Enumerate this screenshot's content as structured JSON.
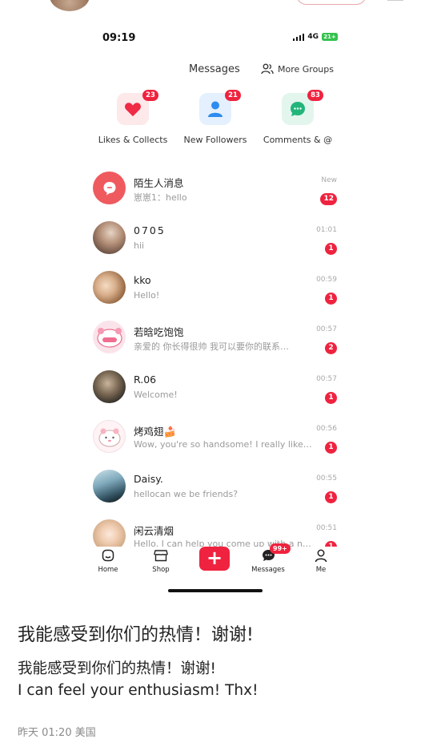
{
  "status_bar": {
    "time": "09:19",
    "network": "4G",
    "battery": "21+"
  },
  "header": {
    "title": "Messages",
    "more_groups": "More Groups"
  },
  "categories": [
    {
      "label": "Likes & Collects",
      "badge": "23",
      "icon": "heart-icon",
      "color": "#ef2b45"
    },
    {
      "label": "New Followers",
      "badge": "21",
      "icon": "person-icon",
      "color": "#2d8cf0"
    },
    {
      "label": "Comments & @",
      "badge": "83",
      "icon": "chat-bubble-icon",
      "color": "#22b57a"
    }
  ],
  "conversations": [
    {
      "name": "陌生人消息",
      "preview": "崽崽1：hello",
      "time": "New",
      "badge": "12",
      "avatar": "stranger-message-icon"
    },
    {
      "name": "0705",
      "preview": "hii",
      "time": "01:01",
      "badge": "1"
    },
    {
      "name": "kko",
      "preview": "Hello!",
      "time": "00:59",
      "badge": "1"
    },
    {
      "name": "若晗吃饱饱",
      "preview": "亲爱的 你长得很帅 我可以要你的联系…",
      "time": "00:57",
      "badge": "2"
    },
    {
      "name": "R.06",
      "preview": "Welcome!",
      "time": "00:57",
      "badge": "1"
    },
    {
      "name": "烤鸡翅🍰",
      "preview": "Wow, you're so handsome! I really like…",
      "time": "00:56",
      "badge": "1"
    },
    {
      "name": "Daisy.",
      "preview": "hellocan we be friends?",
      "time": "00:55",
      "badge": "1"
    },
    {
      "name": "闲云清烟",
      "preview": "Hello. I can help you come up with a n…",
      "time": "00:51",
      "badge": "1"
    }
  ],
  "tab_bar": {
    "home": "Home",
    "shop": "Shop",
    "plus": "+",
    "messages": "Messages",
    "messages_badge": "99+",
    "me": "Me"
  },
  "caption": {
    "title": "我能感受到你们的热情！谢谢!",
    "line1": "我能感受到你们的热情！谢谢!",
    "line2": "I can feel your enthusiasm! Thx!",
    "meta": "昨天 01:20 美国"
  },
  "colors": {
    "accent": "#ef233f"
  }
}
